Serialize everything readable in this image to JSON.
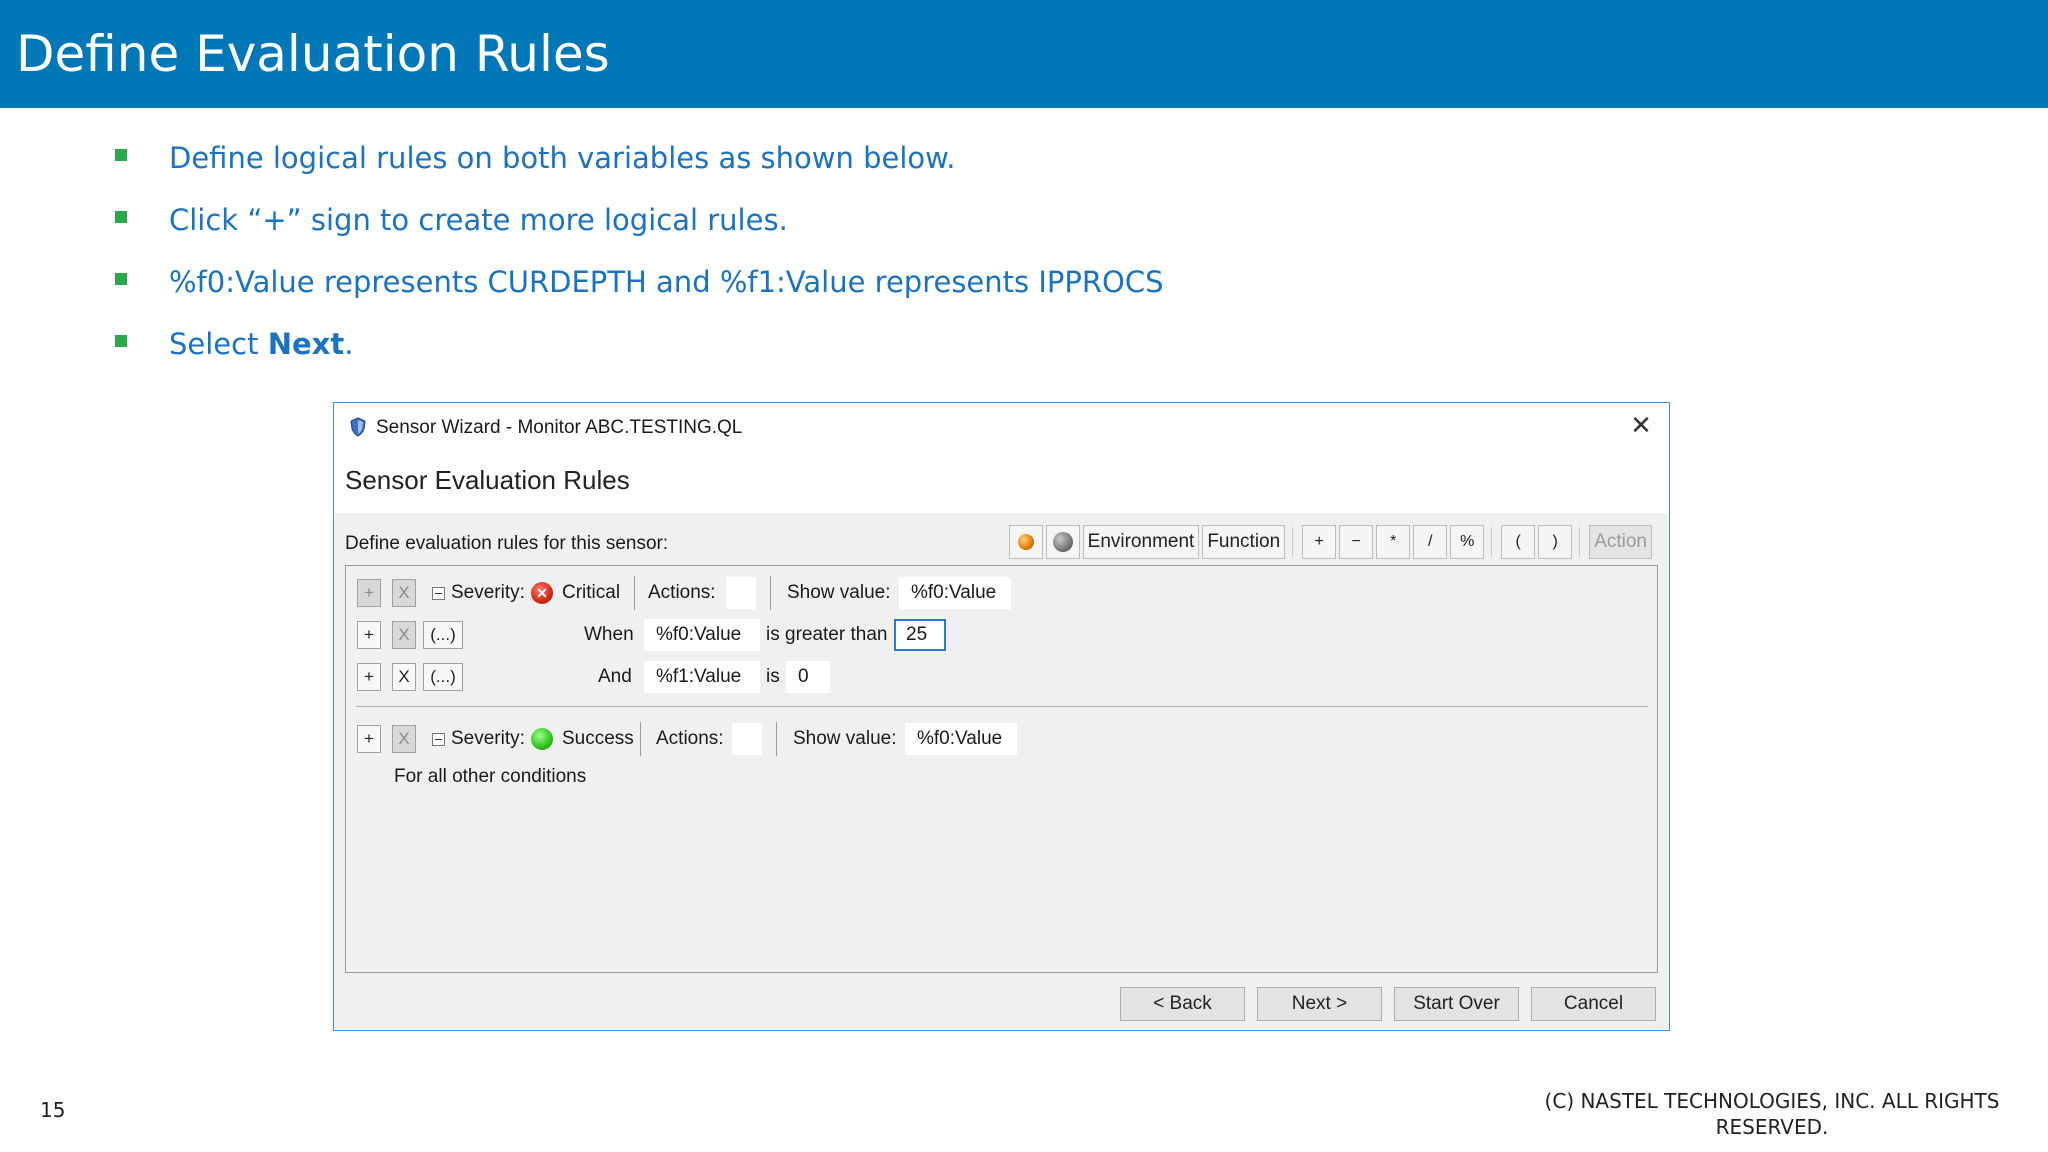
{
  "slide": {
    "title": "Define Evaluation Rules",
    "bullets": [
      {
        "text": "Define logical rules on both variables as shown below."
      },
      {
        "text": "Click “+” sign to create more logical rules."
      },
      {
        "text": "%f0:Value represents CURDEPTH and %f1:Value represents IPPROCS"
      },
      {
        "prefix": "Select ",
        "bold": "Next",
        "suffix": "."
      }
    ],
    "page_number": "15",
    "copyright_line1": "(C) NASTEL TECHNOLOGIES, INC. ALL RIGHTS",
    "copyright_line2": "RESERVED.",
    "accent_color": "#0078b8",
    "bullet_color": "#2aa84a"
  },
  "dialog": {
    "window_title": "Sensor Wizard - Monitor ABC.TESTING.QL",
    "close_glyph": "✕",
    "heading": "Sensor Evaluation Rules",
    "define_label": "Define evaluation rules for this sensor:",
    "toolbar": {
      "environment": "Environment",
      "function": "Function",
      "plus": "+",
      "minus": "−",
      "multiply": "*",
      "divide": "/",
      "percent": "%",
      "open_paren": "(",
      "close_paren": ")",
      "action": "Action"
    },
    "rule1": {
      "plus": "+",
      "x": "X",
      "severity_label": "Severity:",
      "severity_icon": "critical-icon",
      "severity_value": "Critical",
      "actions_label": "Actions:",
      "show_value_label": "Show value:",
      "show_value": "%f0:Value",
      "conditions": [
        {
          "plus": "+",
          "x": "X",
          "parens": "(...)",
          "keyword": "When",
          "variable": "%f0:Value",
          "operator": "is greater than",
          "value": "25"
        },
        {
          "plus": "+",
          "x": "X",
          "parens": "(...)",
          "keyword": "And",
          "variable": "%f1:Value",
          "operator": "is",
          "value": "0"
        }
      ]
    },
    "rule2": {
      "plus": "+",
      "x": "X",
      "severity_label": "Severity:",
      "severity_icon": "success-icon",
      "severity_value": "Success",
      "actions_label": "Actions:",
      "show_value_label": "Show value:",
      "show_value": "%f0:Value",
      "other_conditions": "For all other conditions"
    },
    "buttons": {
      "back": "< Back",
      "next": "Next >",
      "start_over": "Start Over",
      "cancel": "Cancel"
    }
  }
}
